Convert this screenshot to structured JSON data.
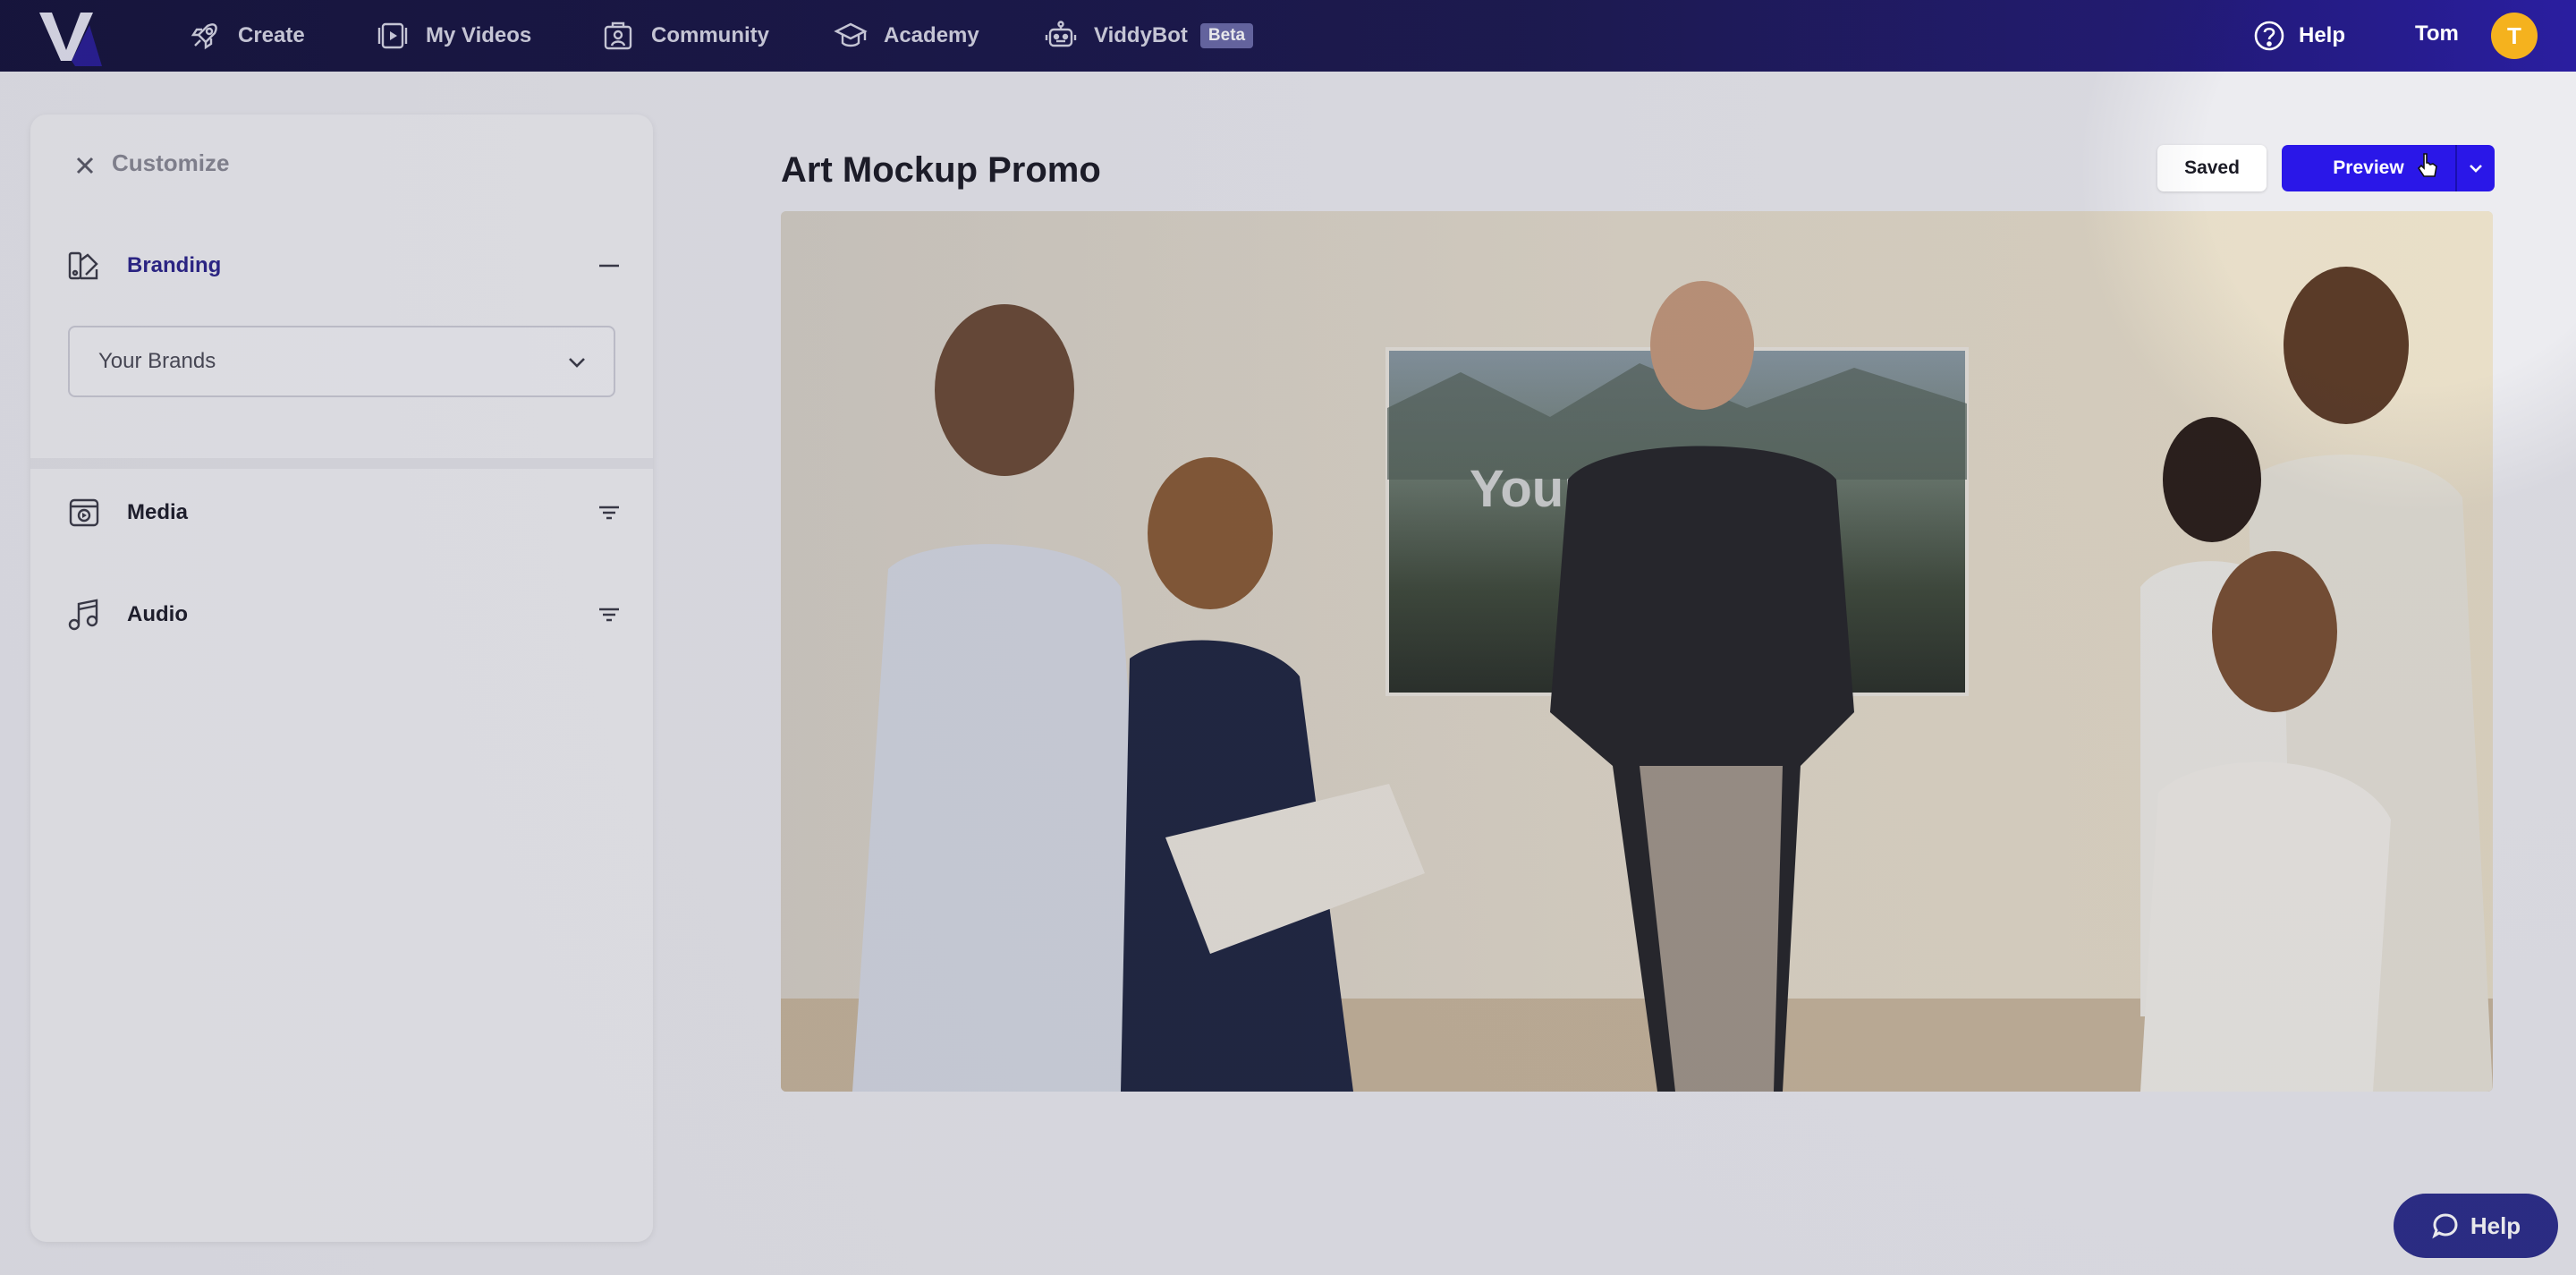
{
  "nav": {
    "items": [
      {
        "label": "Create",
        "icon": "rocket-icon"
      },
      {
        "label": "My Videos",
        "icon": "video-icon"
      },
      {
        "label": "Community",
        "icon": "community-icon"
      },
      {
        "label": "Academy",
        "icon": "graduation-cap-icon"
      },
      {
        "label": "ViddyBot",
        "icon": "robot-icon",
        "badge": "Beta"
      }
    ],
    "help_label": "Help",
    "user_name": "Tom",
    "avatar_initial": "T"
  },
  "sidebar": {
    "title": "Customize",
    "sections": [
      {
        "label": "Branding",
        "expanded": true,
        "icon": "palette-swatch-icon"
      },
      {
        "label": "Media",
        "icon": "media-icon"
      },
      {
        "label": "Audio",
        "icon": "music-note-icon"
      }
    ],
    "brand_select": {
      "value": "Your Brands"
    }
  },
  "main": {
    "title": "Art Mockup Promo",
    "saved_label": "Saved",
    "preview_label": "Preview",
    "video_poster_text": "Your Here"
  },
  "chat_help_label": "Help",
  "colors": {
    "accent": "#2a17e8",
    "nav_bg": "#14123a",
    "avatar": "#f5b21e",
    "branding_text": "#2b248a"
  }
}
